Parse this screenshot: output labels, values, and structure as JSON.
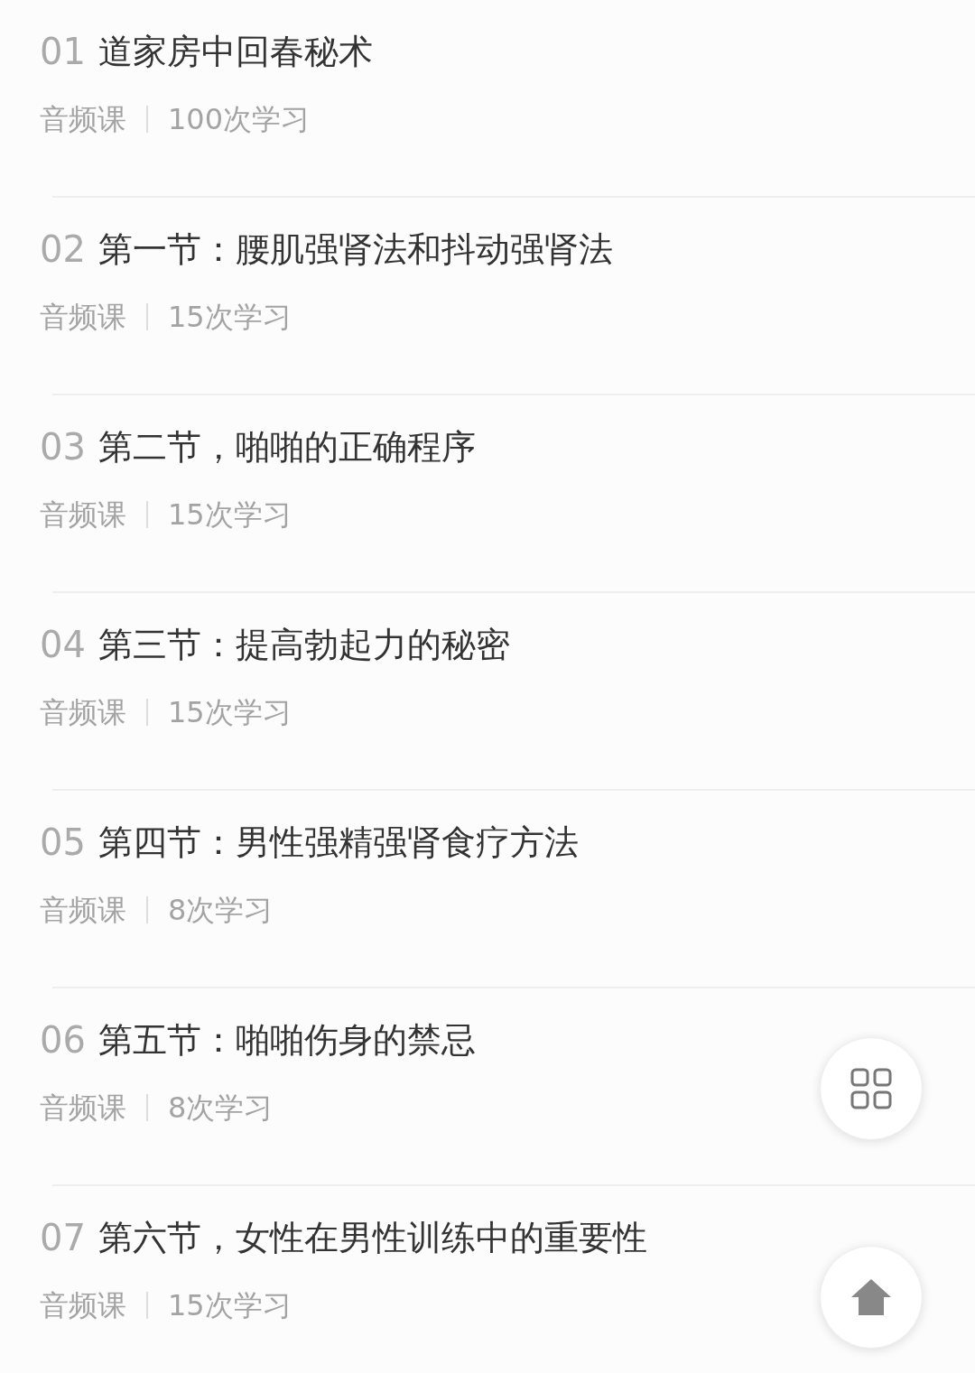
{
  "lessons": [
    {
      "number": "01",
      "title": "道家房中回春秘术",
      "type": "音频课",
      "count": "100次学习"
    },
    {
      "number": "02",
      "title": "第一节：腰肌强肾法和抖动强肾法",
      "type": "音频课",
      "count": "15次学习"
    },
    {
      "number": "03",
      "title": "第二节，啪啪的正确程序",
      "type": "音频课",
      "count": "15次学习"
    },
    {
      "number": "04",
      "title": "第三节：提高勃起力的秘密",
      "type": "音频课",
      "count": "15次学习"
    },
    {
      "number": "05",
      "title": "第四节：男性强精强肾食疗方法",
      "type": "音频课",
      "count": "8次学习"
    },
    {
      "number": "06",
      "title": "第五节：啪啪伤身的禁忌",
      "type": "音频课",
      "count": "8次学习"
    },
    {
      "number": "07",
      "title": "第六节，女性在男性训练中的重要性",
      "type": "音频课",
      "count": "15次学习"
    }
  ]
}
